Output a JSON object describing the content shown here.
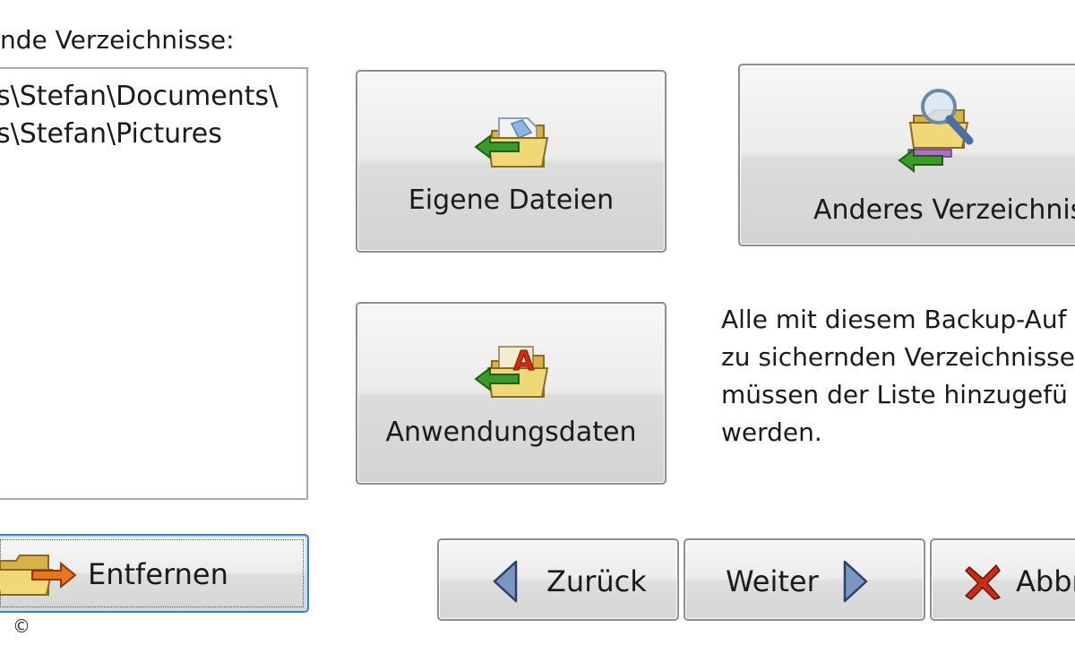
{
  "list": {
    "label": "nde Verzeichnisse:",
    "items": [
      "s\\Stefan\\Documents\\",
      "s\\Stefan\\Pictures"
    ]
  },
  "buttons": {
    "eigene_dateien": "Eigene Dateien",
    "anwendungsdaten": "Anwendungsdaten",
    "anderes_verzeichnis": "Anderes Verzeichnis"
  },
  "info": {
    "lines": [
      "Alle mit diesem Backup-Auf",
      "zu sichernden Verzeichnisse",
      "müssen der Liste hinzugefü",
      "werden."
    ]
  },
  "footer": {
    "entfernen": "Entfernen",
    "zurueck": "Zurück",
    "weiter": "Weiter",
    "abbrechen": "Abbr"
  },
  "copyright": "©",
  "colors": {
    "arrow_green": "#3a9b2a",
    "arrow_orange": "#e8761c",
    "folder_yellow": "#e6c86a",
    "nav_arrow_blue": "#6a86b5",
    "cancel_red": "#cc2a1a",
    "focus_blue": "#3d7fc4"
  }
}
